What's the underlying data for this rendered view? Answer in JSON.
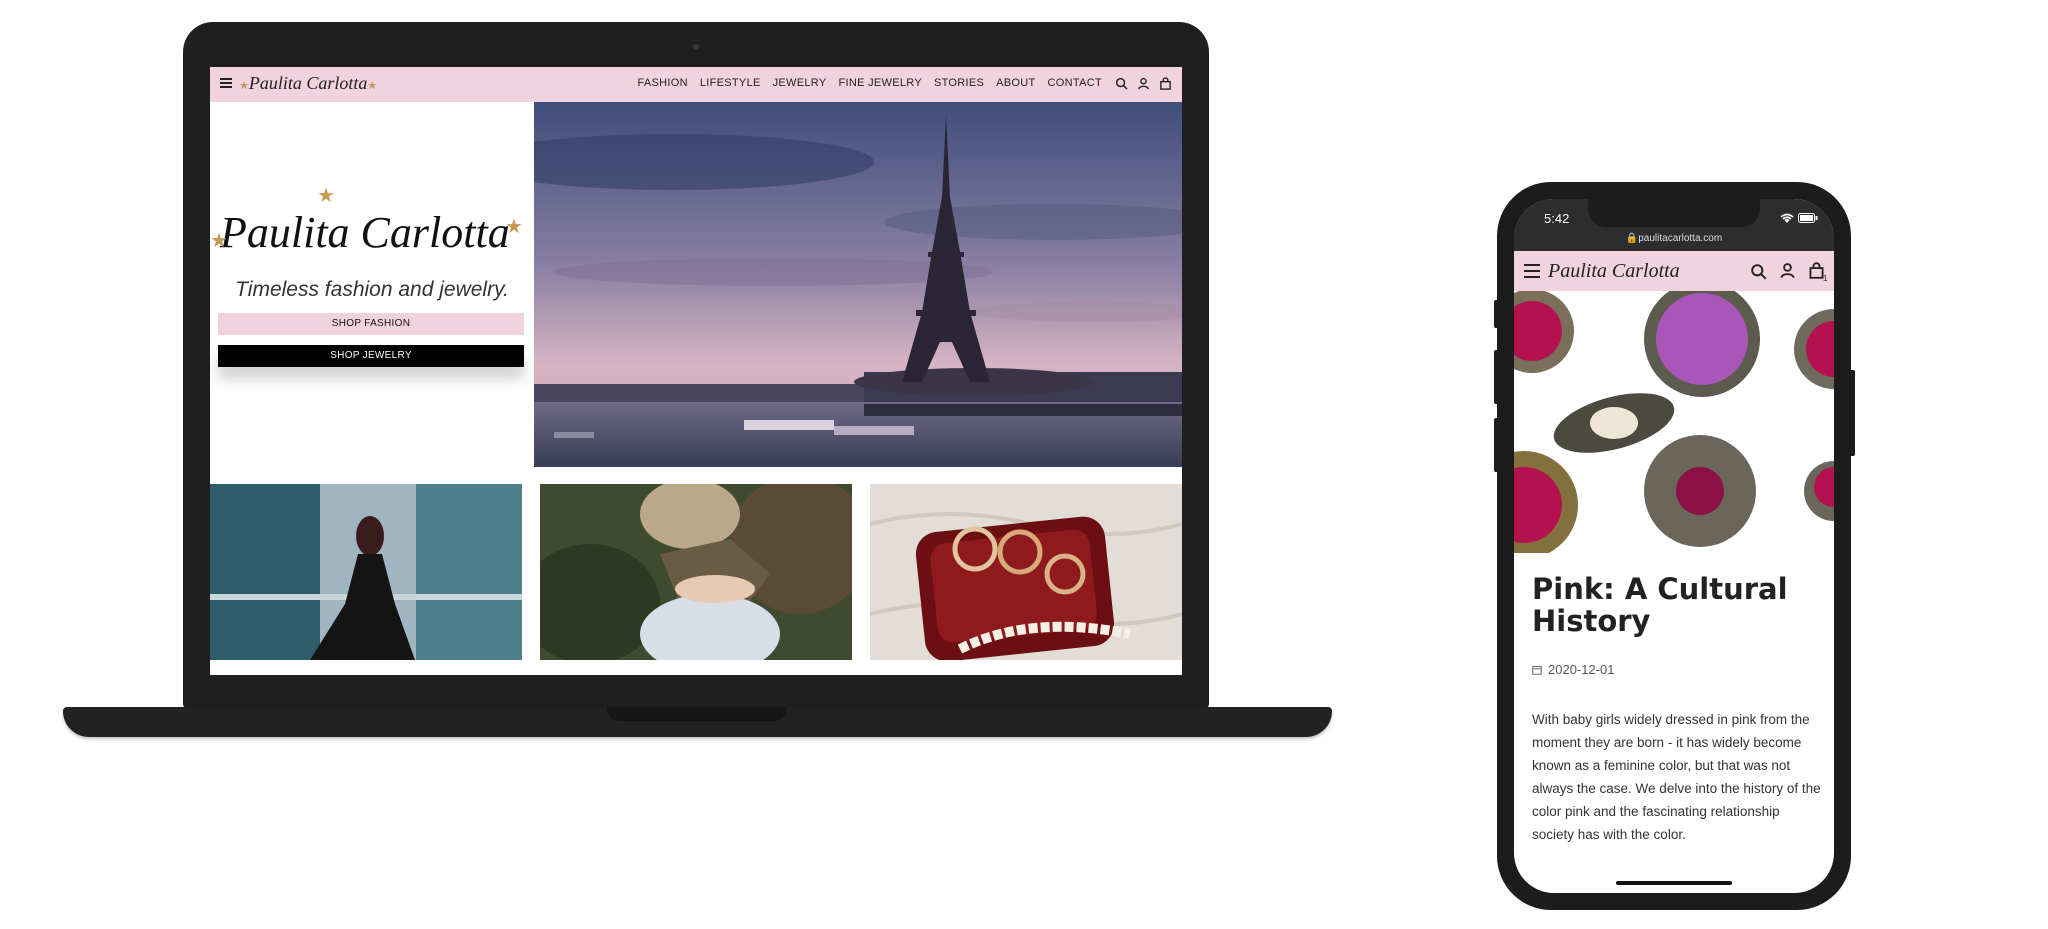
{
  "brand": "Paulita Carlotta",
  "colors": {
    "accent_pink": "#f1d3df",
    "gold_star": "#c69a55",
    "dark": "#000000"
  },
  "desktop": {
    "nav": {
      "menu_items": [
        "FASHION",
        "LIFESTYLE",
        "JEWELRY",
        "FINE JEWELRY",
        "STORIES",
        "ABOUT",
        "CONTACT"
      ],
      "icons": [
        "menu-icon",
        "search-icon",
        "user-icon",
        "bag-icon"
      ]
    },
    "hero": {
      "tagline": "Timeless fashion and jewelry.",
      "shop_fashion": "SHOP FASHION",
      "shop_jewelry": "SHOP JEWELRY",
      "image": "eiffel-tower-sunset"
    },
    "tiles": [
      "woman-black-dress-balcony",
      "hands-with-rings",
      "rings-red-velvet-box"
    ]
  },
  "mobile": {
    "status_time": "5:42",
    "url": "paulitacarlotta.com",
    "cart_count": "1",
    "article": {
      "title": "Pink: A Cultural History",
      "date": "2020-12-01",
      "body": "With baby girls widely dressed in pink from the moment they are born - it has widely become known as a feminine color, but that was not always the case. We delve into the history of the color pink and the fascinating relationship society has with the color."
    }
  }
}
